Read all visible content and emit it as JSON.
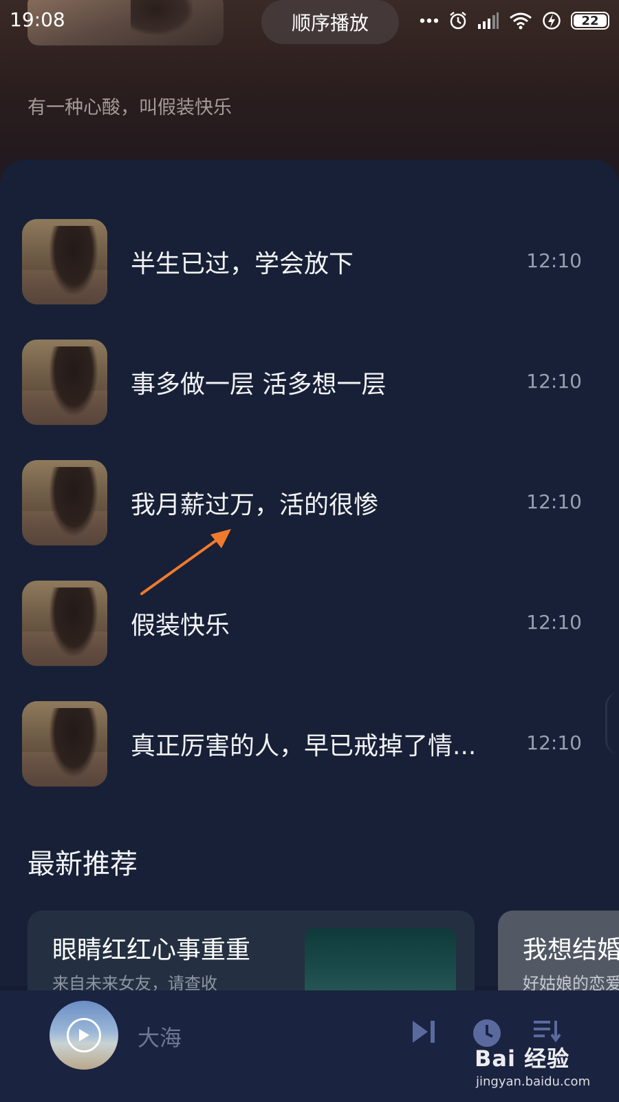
{
  "status_bar": {
    "time": "19:08",
    "battery": "22",
    "icons": [
      "more-dots-icon",
      "alarm-icon",
      "signal-icon",
      "wifi-icon",
      "charging-icon",
      "battery-icon"
    ]
  },
  "header": {
    "play_mode": "顺序播放",
    "subtitle": "有一种心酸，叫假装快乐"
  },
  "songs": [
    {
      "title": "半生已过，学会放下",
      "duration": "12:10"
    },
    {
      "title": "事多做一层 活多想一层",
      "duration": "12:10"
    },
    {
      "title": "我月薪过万，活的很惨",
      "duration": "12:10"
    },
    {
      "title": "假装快乐",
      "duration": "12:10"
    },
    {
      "title": "真正厉害的人，早已戒掉了情...",
      "duration": "12:10"
    }
  ],
  "recommend": {
    "section_title": "最新推荐",
    "cards": [
      {
        "title": "眼睛红红心事重重",
        "subtitle": "来自未来女友，请查收"
      },
      {
        "title": "我想结婚",
        "subtitle": "好姑娘的恋爱"
      }
    ]
  },
  "player": {
    "song": "大海",
    "controls": [
      "next-icon",
      "timer-icon",
      "playlist-icon"
    ]
  },
  "watermark": {
    "brand": "Bai 经验",
    "url": "jingyan.baidu.com"
  },
  "colors": {
    "background": "#151c30",
    "card": "#172036",
    "player_bar": "#1a2340",
    "arrow": "#f07a2e"
  }
}
